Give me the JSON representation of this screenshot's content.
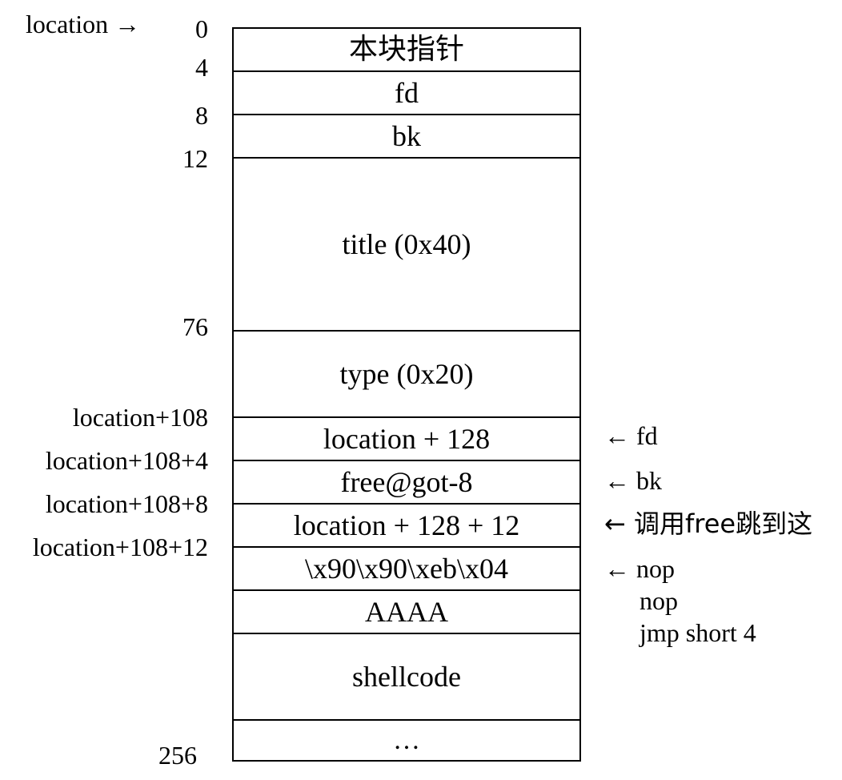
{
  "start_label": "location →",
  "cells": [
    "本块指针",
    "fd",
    "bk",
    "title (0x40)",
    "type (0x20)",
    "location + 128",
    "free@got-8",
    "location + 128 + 12",
    "\\x90\\x90\\xeb\\x04",
    "AAAA",
    "shellcode",
    "…"
  ],
  "offsets": [
    "0",
    "4",
    "8",
    "12",
    "76",
    "location+108",
    "location+108+4",
    "location+108+8",
    "location+108+12",
    "256"
  ],
  "notes": [
    "← fd",
    "← bk",
    "← 调用free跳到这",
    "← nop",
    "nop",
    "jmp short 4"
  ]
}
